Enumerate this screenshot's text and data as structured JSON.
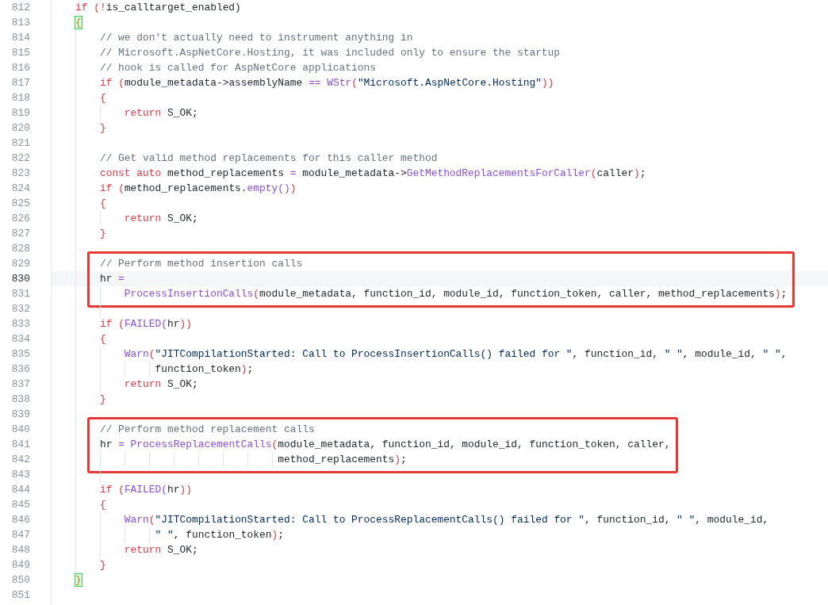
{
  "editor": {
    "blocks": [
      {
        "boxed": false,
        "lines": [
          {
            "number": "812",
            "selected": false,
            "tokens": [
              {
                "kind": "keyword",
                "text": "    if "
              },
              {
                "kind": "punct",
                "text": "(!"
              },
              {
                "kind": "ident",
                "text": "is_calltarget_enabled)"
              }
            ]
          },
          {
            "number": "813",
            "selected": false,
            "tokens": [
              {
                "kind": "match",
                "text": "    {"
              }
            ]
          },
          {
            "number": "814",
            "selected": false,
            "tokens": [
              {
                "kind": "comment",
                "text": "        // we don't actually need to instrument anything in"
              }
            ]
          },
          {
            "number": "815",
            "selected": false,
            "tokens": [
              {
                "kind": "comment",
                "text": "        // Microsoft.AspNetCore.Hosting, it was included only to ensure the startup"
              }
            ]
          },
          {
            "number": "816",
            "selected": false,
            "tokens": [
              {
                "kind": "comment",
                "text": "        // hook is called for AspNetCore applications"
              }
            ]
          },
          {
            "number": "817",
            "selected": false,
            "tokens": [
              {
                "kind": "keyword",
                "text": "        if "
              },
              {
                "kind": "punct",
                "text": "("
              },
              {
                "kind": "ident",
                "text": "module_metadata->assemblyName "
              },
              {
                "kind": "operator",
                "text": "== "
              },
              {
                "kind": "function",
                "text": "WStr"
              },
              {
                "kind": "punct",
                "text": "("
              },
              {
                "kind": "string",
                "text": "\"Microsoft.AspNetCore.Hosting\""
              },
              {
                "kind": "punct",
                "text": "))"
              }
            ]
          },
          {
            "number": "818",
            "selected": false,
            "tokens": [
              {
                "kind": "punct",
                "text": "        {"
              }
            ]
          },
          {
            "number": "819",
            "selected": false,
            "tokens": [
              {
                "kind": "keyword",
                "text": "            return "
              },
              {
                "kind": "ident",
                "text": "S_OK;"
              }
            ]
          },
          {
            "number": "820",
            "selected": false,
            "tokens": [
              {
                "kind": "punct",
                "text": "        }"
              }
            ]
          },
          {
            "number": "821",
            "selected": false
          },
          {
            "number": "822",
            "selected": false,
            "tokens": [
              {
                "kind": "comment",
                "text": "        // Get valid method replacements for this caller method"
              }
            ]
          },
          {
            "number": "823",
            "selected": false,
            "tokens": [
              {
                "kind": "keyword",
                "text": "        const auto "
              },
              {
                "kind": "ident",
                "text": "method_replacements "
              },
              {
                "kind": "operator",
                "text": "= "
              },
              {
                "kind": "ident",
                "text": "module_metadata->"
              },
              {
                "kind": "function",
                "text": "GetMethodReplacementsForCaller"
              },
              {
                "kind": "punct",
                "text": "("
              },
              {
                "kind": "ident",
                "text": "caller"
              },
              {
                "kind": "punct",
                "text": ")"
              },
              {
                "kind": "ident",
                "text": ";"
              }
            ]
          },
          {
            "number": "824",
            "selected": false,
            "tokens": [
              {
                "kind": "keyword",
                "text": "        if "
              },
              {
                "kind": "punct",
                "text": "("
              },
              {
                "kind": "ident",
                "text": "method_replacements."
              },
              {
                "kind": "function",
                "text": "empty()"
              },
              {
                "kind": "punct",
                "text": ")"
              }
            ]
          },
          {
            "number": "825",
            "selected": false,
            "tokens": [
              {
                "kind": "punct",
                "text": "        {"
              }
            ]
          },
          {
            "number": "826",
            "selected": false,
            "tokens": [
              {
                "kind": "keyword",
                "text": "            return "
              },
              {
                "kind": "ident",
                "text": "S_OK;"
              }
            ]
          },
          {
            "number": "827",
            "selected": false,
            "tokens": [
              {
                "kind": "punct",
                "text": "        }"
              }
            ]
          },
          {
            "number": "828",
            "selected": false
          }
        ]
      },
      {
        "boxed": true,
        "lines": [
          {
            "number": "829",
            "selected": false,
            "tokens": [
              {
                "kind": "comment",
                "text": "        // Perform method insertion calls"
              }
            ]
          },
          {
            "number": "830",
            "selected": true,
            "tokens": [
              {
                "kind": "ident",
                "text": "        hr "
              },
              {
                "kind": "operator",
                "text": "="
              }
            ]
          },
          {
            "number": "831",
            "selected": false,
            "tokens": [
              {
                "kind": "function",
                "text": "            ProcessInsertionCalls"
              },
              {
                "kind": "punct",
                "text": "("
              },
              {
                "kind": "ident",
                "text": "module_metadata, function_id, module_id, function_token, caller, method_replacements"
              },
              {
                "kind": "punct",
                "text": ")"
              },
              {
                "kind": "ident",
                "text": ";"
              }
            ]
          }
        ]
      },
      {
        "boxed": false,
        "lines": [
          {
            "number": "832",
            "selected": false
          },
          {
            "number": "833",
            "selected": false,
            "tokens": [
              {
                "kind": "keyword",
                "text": "        if "
              },
              {
                "kind": "punct",
                "text": "("
              },
              {
                "kind": "function",
                "text": "FAILED("
              },
              {
                "kind": "ident",
                "text": "hr"
              },
              {
                "kind": "punct",
                "text": "))"
              }
            ]
          },
          {
            "number": "834",
            "selected": false,
            "tokens": [
              {
                "kind": "punct",
                "text": "        {"
              }
            ]
          },
          {
            "number": "835",
            "selected": false,
            "tokens": [
              {
                "kind": "function",
                "text": "            Warn"
              },
              {
                "kind": "punct",
                "text": "("
              },
              {
                "kind": "string",
                "text": "\"JITCompilationStarted: Call to ProcessInsertionCalls() failed for \""
              },
              {
                "kind": "ident",
                "text": ", function_id, "
              },
              {
                "kind": "string",
                "text": "\" \""
              },
              {
                "kind": "ident",
                "text": ", module_id, "
              },
              {
                "kind": "string",
                "text": "\" \""
              },
              {
                "kind": "ident",
                "text": ","
              }
            ]
          },
          {
            "number": "836",
            "selected": false,
            "tokens": [
              {
                "kind": "ident",
                "text": "                 function_token"
              },
              {
                "kind": "punct",
                "text": ")"
              },
              {
                "kind": "ident",
                "text": ";"
              }
            ]
          },
          {
            "number": "837",
            "selected": false,
            "tokens": [
              {
                "kind": "keyword",
                "text": "            return "
              },
              {
                "kind": "ident",
                "text": "S_OK;"
              }
            ]
          },
          {
            "number": "838",
            "selected": false,
            "tokens": [
              {
                "kind": "punct",
                "text": "        }"
              }
            ]
          },
          {
            "number": "839",
            "selected": false
          }
        ]
      },
      {
        "boxed": true,
        "lines": [
          {
            "number": "840",
            "selected": false,
            "tokens": [
              {
                "kind": "comment",
                "text": "        // Perform method replacement calls"
              }
            ]
          },
          {
            "number": "841",
            "selected": false,
            "tokens": [
              {
                "kind": "ident",
                "text": "        hr "
              },
              {
                "kind": "operator",
                "text": "= "
              },
              {
                "kind": "function",
                "text": "ProcessReplacementCalls"
              },
              {
                "kind": "punct",
                "text": "("
              },
              {
                "kind": "ident",
                "text": "module_metadata, function_id, module_id, function_token, caller,"
              }
            ]
          },
          {
            "number": "842",
            "selected": false,
            "tokens": [
              {
                "kind": "ident",
                "text": "                                     method_replacements"
              },
              {
                "kind": "punct",
                "text": ")"
              },
              {
                "kind": "ident",
                "text": ";"
              }
            ]
          }
        ]
      },
      {
        "boxed": false,
        "lines": [
          {
            "number": "843",
            "selected": false
          },
          {
            "number": "844",
            "selected": false,
            "tokens": [
              {
                "kind": "keyword",
                "text": "        if "
              },
              {
                "kind": "punct",
                "text": "("
              },
              {
                "kind": "function",
                "text": "FAILED("
              },
              {
                "kind": "ident",
                "text": "hr"
              },
              {
                "kind": "punct",
                "text": "))"
              }
            ]
          },
          {
            "number": "845",
            "selected": false,
            "tokens": [
              {
                "kind": "punct",
                "text": "        {"
              }
            ]
          },
          {
            "number": "846",
            "selected": false,
            "tokens": [
              {
                "kind": "function",
                "text": "            Warn"
              },
              {
                "kind": "punct",
                "text": "("
              },
              {
                "kind": "string",
                "text": "\"JITCompilationStarted: Call to ProcessReplacementCalls() failed for \""
              },
              {
                "kind": "ident",
                "text": ", function_id, "
              },
              {
                "kind": "string",
                "text": "\" \""
              },
              {
                "kind": "ident",
                "text": ", module_id,"
              }
            ]
          },
          {
            "number": "847",
            "selected": false,
            "tokens": [
              {
                "kind": "string",
                "text": "                 \" \""
              },
              {
                "kind": "ident",
                "text": ", function_token"
              },
              {
                "kind": "punct",
                "text": ")"
              },
              {
                "kind": "ident",
                "text": ";"
              }
            ]
          },
          {
            "number": "848",
            "selected": false,
            "tokens": [
              {
                "kind": "keyword",
                "text": "            return "
              },
              {
                "kind": "ident",
                "text": "S_OK;"
              }
            ]
          },
          {
            "number": "849",
            "selected": false,
            "tokens": [
              {
                "kind": "punct",
                "text": "        }"
              }
            ]
          },
          {
            "number": "850",
            "selected": false,
            "tokens": [
              {
                "kind": "match",
                "text": "    }"
              }
            ]
          },
          {
            "number": "851",
            "selected": false
          }
        ]
      }
    ]
  }
}
